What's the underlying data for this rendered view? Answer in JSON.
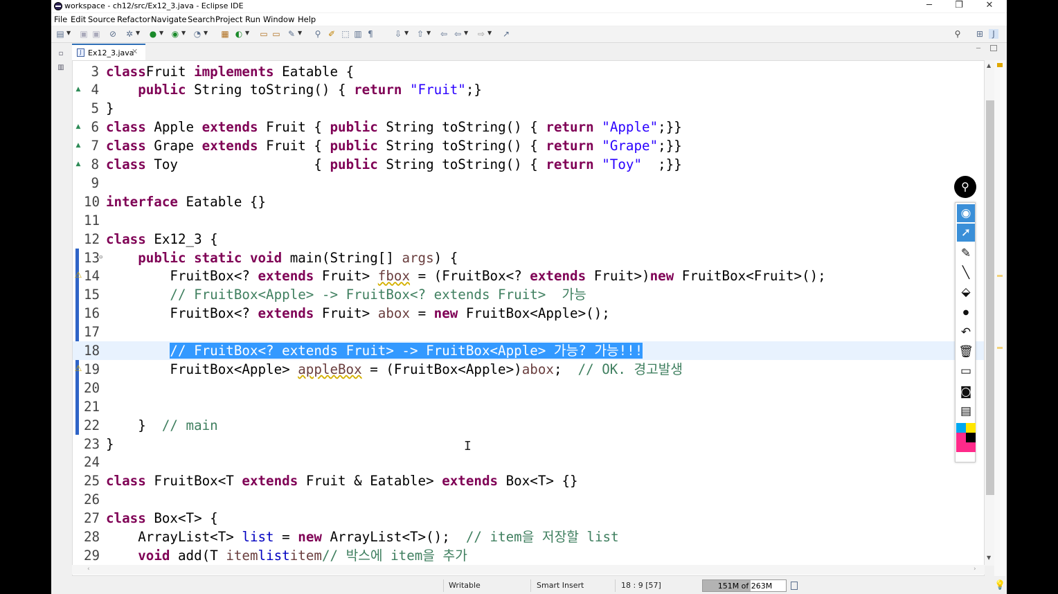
{
  "window": {
    "title": "workspace - ch12/src/Ex12_3.java - Eclipse IDE",
    "minimize_glyph": "─",
    "restore_glyph": "❐",
    "close_glyph": "✕"
  },
  "menu": {
    "items": [
      "File",
      "Edit",
      "Source",
      "Refactor",
      "Navigate",
      "Search",
      "Project",
      "Run",
      "Window",
      "Help"
    ]
  },
  "toolbar": {
    "icons": [
      "new-icon",
      "save-icon",
      "save-all-icon",
      "skip-breakpoints-icon",
      "debug-icon",
      "run-icon",
      "run-external-icon",
      "coverage-icon",
      "new-java-project-icon",
      "new-class-icon",
      "open-type-icon",
      "search-icon",
      "toggle-mark-icon",
      "annotation-icon",
      "show-whitespace-icon",
      "next-annotation-icon",
      "previous-annotation-icon",
      "back-icon",
      "forward-icon",
      "pin-editor-icon"
    ],
    "search_icon": "search-icon",
    "perspective_icons": [
      "open-perspective-icon",
      "java-perspective-icon"
    ]
  },
  "editor": {
    "tab_label": "Ex12_3.java",
    "current_line": 18,
    "lines": [
      {
        "num": "3",
        "tokens": [
          [
            "kw",
            "class"
          ],
          [
            "",
            "Fruit "
          ],
          [
            "kw",
            "implements"
          ],
          [
            "",
            " Eatable {"
          ]
        ]
      },
      {
        "num": "4",
        "tokens": [
          [
            "",
            "    "
          ],
          [
            "kw",
            "public"
          ],
          [
            "",
            " String toString() { "
          ],
          [
            "kw",
            "return"
          ],
          [
            "",
            " "
          ],
          [
            "str",
            "\"Fruit\""
          ],
          [
            "",
            ";}"
          ]
        ]
      },
      {
        "num": "5",
        "tokens": [
          [
            "",
            "}"
          ]
        ]
      },
      {
        "num": "6",
        "tokens": [
          [
            "kw",
            "class"
          ],
          [
            "",
            " Apple "
          ],
          [
            "kw",
            "extends"
          ],
          [
            "",
            " Fruit { "
          ],
          [
            "kw",
            "public"
          ],
          [
            "",
            " String toString() { "
          ],
          [
            "kw",
            "return"
          ],
          [
            "",
            " "
          ],
          [
            "str",
            "\"Apple\""
          ],
          [
            "",
            ";}}"
          ]
        ]
      },
      {
        "num": "7",
        "tokens": [
          [
            "kw",
            "class"
          ],
          [
            "",
            " Grape "
          ],
          [
            "kw",
            "extends"
          ],
          [
            "",
            " Fruit { "
          ],
          [
            "kw",
            "public"
          ],
          [
            "",
            " String toString() { "
          ],
          [
            "kw",
            "return"
          ],
          [
            "",
            " "
          ],
          [
            "str",
            "\"Grape\""
          ],
          [
            "",
            ";}}"
          ]
        ]
      },
      {
        "num": "8",
        "tokens": [
          [
            "kw",
            "class"
          ],
          [
            "",
            " Toy                 { "
          ],
          [
            "kw",
            "public"
          ],
          [
            "",
            " String toString() { "
          ],
          [
            "kw",
            "return"
          ],
          [
            "",
            " "
          ],
          [
            "str",
            "\"Toy\""
          ],
          [
            "",
            "  ;}}"
          ]
        ]
      },
      {
        "num": "9",
        "tokens": []
      },
      {
        "num": "10",
        "tokens": [
          [
            "kw",
            "interface"
          ],
          [
            "",
            " Eatable {}"
          ]
        ]
      },
      {
        "num": "11",
        "tokens": []
      },
      {
        "num": "12",
        "tokens": [
          [
            "kw",
            "class"
          ],
          [
            "",
            " Ex12_3 {"
          ]
        ]
      },
      {
        "num": "13",
        "tokens": [
          [
            "",
            "    "
          ],
          [
            "kw",
            "public static void"
          ],
          [
            "",
            " main(String[] "
          ],
          [
            "var",
            "args"
          ],
          [
            "",
            ") {"
          ]
        ]
      },
      {
        "num": "14",
        "tokens": [
          [
            "",
            "        FruitBox<? "
          ],
          [
            "kw",
            "extends"
          ],
          [
            "",
            " Fruit> "
          ],
          [
            "var warn-ul",
            "fbox"
          ],
          [
            "",
            " = (FruitBox<? "
          ],
          [
            "kw",
            "extends"
          ],
          [
            "",
            " Fruit>)"
          ],
          [
            "kw",
            "new"
          ],
          [
            "",
            " FruitBox<Fruit>();"
          ]
        ]
      },
      {
        "num": "15",
        "tokens": [
          [
            "",
            "        "
          ],
          [
            "cmt",
            "// FruitBox<Apple> -> FruitBox<? extends Fruit>  가능"
          ]
        ]
      },
      {
        "num": "16",
        "tokens": [
          [
            "",
            "        FruitBox<? "
          ],
          [
            "kw",
            "extends"
          ],
          [
            "",
            " Fruit> "
          ],
          [
            "var",
            "abox"
          ],
          [
            "",
            " = "
          ],
          [
            "kw",
            "new"
          ],
          [
            "",
            " FruitBox<Apple>();"
          ]
        ]
      },
      {
        "num": "17",
        "tokens": []
      },
      {
        "num": "18",
        "tokens": [
          [
            "",
            "        "
          ],
          [
            "sel",
            "// FruitBox<? extends Fruit> -> FruitBox<Apple> 가능? 가능!!!"
          ]
        ]
      },
      {
        "num": "19",
        "tokens": [
          [
            "",
            "        FruitBox<Apple> "
          ],
          [
            "var warn-ul",
            "appleBox"
          ],
          [
            "",
            " = (FruitBox<Apple>)"
          ],
          [
            "var",
            "abox"
          ],
          [
            "",
            ";  "
          ],
          [
            "cmt",
            "// OK. 경고발생"
          ]
        ]
      },
      {
        "num": "20",
        "tokens": []
      },
      {
        "num": "21",
        "tokens": []
      },
      {
        "num": "22",
        "tokens": [
          [
            "",
            "    }  "
          ],
          [
            "cmt",
            "// main"
          ]
        ]
      },
      {
        "num": "23",
        "tokens": [
          [
            "",
            "}"
          ]
        ]
      },
      {
        "num": "24",
        "tokens": []
      },
      {
        "num": "25",
        "tokens": [
          [
            "kw",
            "class"
          ],
          [
            "",
            " FruitBox<T "
          ],
          [
            "kw",
            "extends"
          ],
          [
            "",
            " Fruit & Eatable> "
          ],
          [
            "kw",
            "extends"
          ],
          [
            "",
            " Box<T> {}"
          ]
        ]
      },
      {
        "num": "26",
        "tokens": []
      },
      {
        "num": "27",
        "tokens": [
          [
            "kw",
            "class"
          ],
          [
            "",
            " Box<T> {"
          ]
        ]
      },
      {
        "num": "28",
        "tokens": [
          [
            "",
            "    ArrayList<T> "
          ],
          [
            "fld",
            "list"
          ],
          [
            "",
            " = "
          ],
          [
            "kw",
            "new"
          ],
          [
            "",
            " ArrayList<T>();  "
          ],
          [
            "cmt",
            "// item을 저장할 list"
          ]
        ]
      },
      {
        "num": "29",
        "tokens": [
          [
            "",
            "    "
          ],
          [
            "kw",
            "void"
          ],
          [
            "",
            " add(T "
          ],
          [
            "var",
            "item"
          ],
          [
            ") { "
          ],
          [
            "fld",
            "list"
          ],
          [
            ".add("
          ],
          [
            "var",
            "item"
          ],
          [
            ");     } "
          ],
          [
            "cmt",
            "// 박스에 item을 추가"
          ]
        ]
      }
    ]
  },
  "status": {
    "writable": "Writable",
    "insert_mode": "Smart Insert",
    "position": "18 : 9 [57]",
    "heap": "151M of 263M",
    "heap_used_fraction": 0.574
  },
  "pen_toolbar": {
    "tools": [
      "eye-icon",
      "pointer-icon",
      "highlighter-icon",
      "pen-icon",
      "eraser-icon",
      "dot-icon",
      "undo-icon",
      "trash-icon",
      "whiteboard-icon",
      "camera-icon",
      "clipboard-icon"
    ],
    "colors": [
      "#00a8f0",
      "#ffe600",
      "#ff2a8a",
      "#000000"
    ]
  },
  "colors": {
    "keyword": "#7f0055",
    "string": "#2a00ff",
    "comment": "#3f7f5f",
    "selection": "#3399ff",
    "current_line": "#e8f2fe"
  }
}
